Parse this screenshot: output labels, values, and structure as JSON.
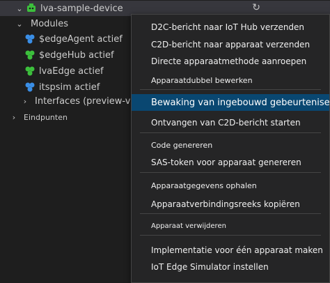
{
  "tree": {
    "device_label": "lva-sample-device",
    "modules_label": "Modules",
    "modules": [
      {
        "label": "$edgeAgent actief",
        "icon": "module-blue-icon"
      },
      {
        "label": "$edgeHub actief",
        "icon": "module-green-icon"
      },
      {
        "label": "lvaEdge actief",
        "icon": "module-green-icon"
      },
      {
        "label": "itspsim actief",
        "icon": "module-blue-icon"
      }
    ],
    "interfaces_label": "Interfaces (preview-versie)",
    "endpoints_label": "Eindpunten"
  },
  "menu": {
    "items": [
      {
        "label": "D2C-bericht naar IoT Hub verzenden"
      },
      {
        "label": "C2D-bericht naar apparaat verzenden"
      },
      {
        "label": "Directe apparaatmethode aanroepen"
      },
      {
        "label": "Apparaatdubbel bewerken"
      },
      {
        "label": "Bewaking van ingebouwd gebeurteniseindpunt starten"
      },
      {
        "label": "Ontvangen van C2D-bericht starten"
      },
      {
        "label": "Code genereren"
      },
      {
        "label": "SAS-token voor apparaat genereren"
      },
      {
        "label": "Apparaatgegevens ophalen"
      },
      {
        "label": "Apparaatverbindingsreeks kopiëren"
      },
      {
        "label": "Apparaat verwijderen"
      },
      {
        "label": "Implementatie voor één apparaat maken"
      },
      {
        "label": "IoT Edge Simulator instellen"
      }
    ]
  },
  "colors": {
    "background": "#1e1e1e",
    "menu_background": "#252526",
    "menu_active": "#094771",
    "selected_row": "#37373d",
    "module_blue": "#3a8ee6",
    "module_green": "#3cbf3c"
  }
}
